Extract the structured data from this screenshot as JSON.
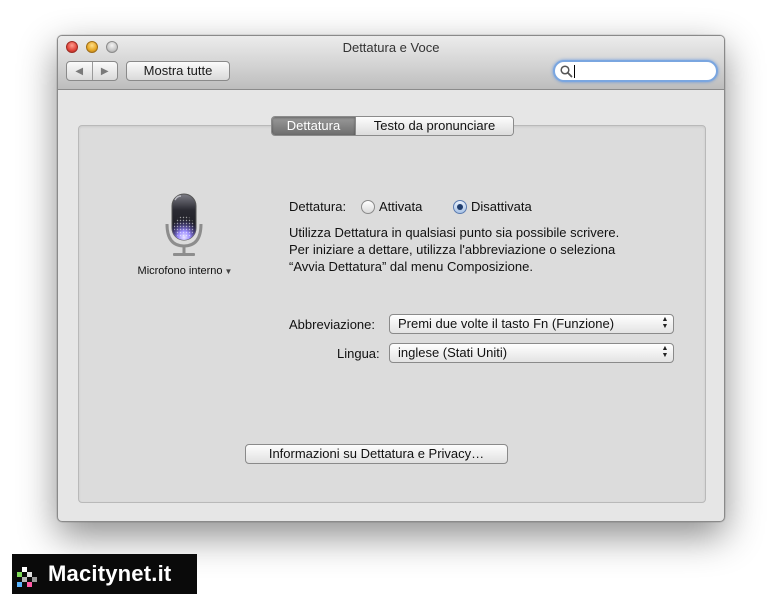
{
  "window": {
    "title": "Dettatura e Voce",
    "toolbar": {
      "back_icon": "◀",
      "forward_icon": "▶",
      "show_all_label": "Mostra tutte"
    },
    "search": {
      "value": "",
      "placeholder": ""
    }
  },
  "tabs": [
    {
      "label": "Dettatura",
      "active": true
    },
    {
      "label": "Testo da pronunciare",
      "active": false
    }
  ],
  "microphone": {
    "label": "Microfono interno",
    "dropdown_arrow": "▼"
  },
  "dictation": {
    "label": "Dettatura:",
    "options": [
      {
        "label": "Attivata",
        "selected": false
      },
      {
        "label": "Disattivata",
        "selected": true
      }
    ],
    "description": [
      "Utilizza Dettatura in qualsiasi punto sia possibile scrivere.",
      "Per iniziare a dettare, utilizza l'abbreviazione o seleziona",
      "“Avvia Dettatura” dal menu Composizione."
    ]
  },
  "shortcut": {
    "label": "Abbreviazione:",
    "value": "Premi due volte il tasto Fn (Funzione)"
  },
  "language": {
    "label": "Lingua:",
    "value": "inglese (Stati Uniti)"
  },
  "info_button_label": "Informazioni su Dettatura e Privacy…",
  "watermark": "Macitynet.it",
  "colors": {
    "selection_blue": "#7aa6e0",
    "active_tab": "#7a7a7a",
    "mic_glow": "#7b6cf0"
  }
}
